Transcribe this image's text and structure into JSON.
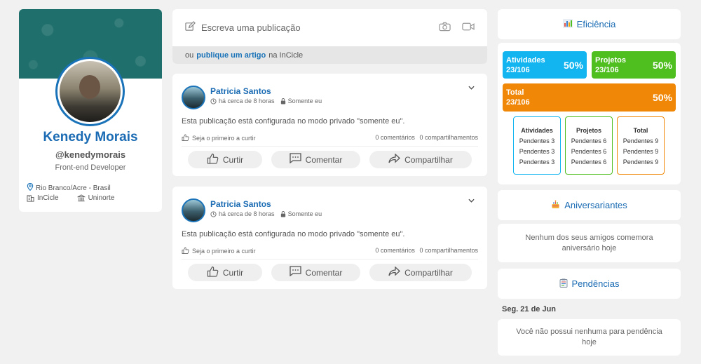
{
  "profile": {
    "name": "Kenedy Morais",
    "handle": "@kenedymorais",
    "role": "Front-end Developer",
    "location": "Rio Branco/Acre - Brasil",
    "company": "InCicle",
    "school": "Uninorte"
  },
  "composer": {
    "placeholder": "Escreva uma publicação",
    "article_prefix": "ou",
    "article_link": "publique um artigo",
    "article_suffix": "na InCicle"
  },
  "posts": [
    {
      "author": "Patricia Santos",
      "time": "há cerca de 8 horas",
      "privacy": "Somente eu",
      "body": "Esta publicação está configurada no modo privado \"somente eu\".",
      "likes_text": "Seja o primeiro a curtir",
      "comments_text": "0 comentários",
      "shares_text": "0 compartilhamentos",
      "like_label": "Curtir",
      "comment_label": "Comentar",
      "share_label": "Compartilhar"
    },
    {
      "author": "Patricia Santos",
      "time": "há cerca de 8 horas",
      "privacy": "Somente eu",
      "body": "Esta publicação está configurada no modo privado \"somente eu\".",
      "likes_text": "Seja o primeiro a curtir",
      "comments_text": "0 comentários",
      "shares_text": "0 compartilhamentos",
      "like_label": "Curtir",
      "comment_label": "Comentar",
      "share_label": "Compartilhar"
    }
  ],
  "efficiency": {
    "title": "Eficiência",
    "atividades": {
      "label": "Atividades",
      "count": "23/106",
      "percent": "50%",
      "color": "#12b5f0"
    },
    "projetos": {
      "label": "Projetos",
      "count": "23/106",
      "percent": "50%",
      "color": "#4fbe1f"
    },
    "total": {
      "label": "Total",
      "count": "23/106",
      "percent": "50%",
      "color": "#f08706"
    },
    "breakdown": [
      {
        "title": "Atividades",
        "lines": [
          "Pendentes 3",
          "Pendentes 3",
          "Pendentes 3"
        ]
      },
      {
        "title": "Projetos",
        "lines": [
          "Pendentes 6",
          "Pendentes 6",
          "Pendentes 6"
        ]
      },
      {
        "title": "Total",
        "lines": [
          "Pendentes 9",
          "Pendentes 9",
          "Pendentes 9"
        ]
      }
    ]
  },
  "birthdays": {
    "title": "Aniversariantes",
    "empty": "Nenhum dos seus amigos comemora aniversário hoje"
  },
  "pending": {
    "title": "Pendências",
    "date": "Seg. 21 de Jun",
    "empty": "Você não possui nenhuma para pendência hoje"
  },
  "icons": {
    "location": "map-pin-icon",
    "company": "building-icon",
    "school": "institution-icon",
    "edit": "pencil-icon",
    "camera": "camera-icon",
    "video": "video-icon",
    "clock": "clock-icon",
    "lock": "lock-icon",
    "like": "thumbs-up-icon",
    "comment": "comment-icon",
    "share": "share-icon",
    "chart": "bar-chart-icon",
    "cake": "cake-icon",
    "tasks": "clipboard-icon"
  }
}
